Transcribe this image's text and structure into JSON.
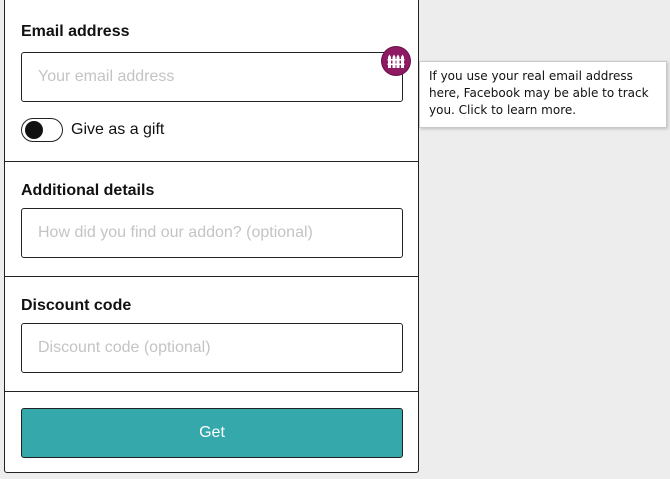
{
  "email": {
    "label": "Email address",
    "placeholder": "Your email address",
    "value": ""
  },
  "gift": {
    "label": "Give as a gift",
    "enabled": false
  },
  "details": {
    "label": "Additional details",
    "placeholder": "How did you find our addon? (optional)",
    "value": ""
  },
  "discount": {
    "label": "Discount code",
    "placeholder": "Discount code (optional)",
    "value": ""
  },
  "submit": {
    "label": "Get"
  },
  "facebook_container": {
    "icon": "fence-icon",
    "badge_color": "#8d1a63",
    "tooltip": "If you use your real email address here, Facebook may be able to track you. Click to learn more."
  },
  "colors": {
    "accent": "#35a8ab"
  }
}
